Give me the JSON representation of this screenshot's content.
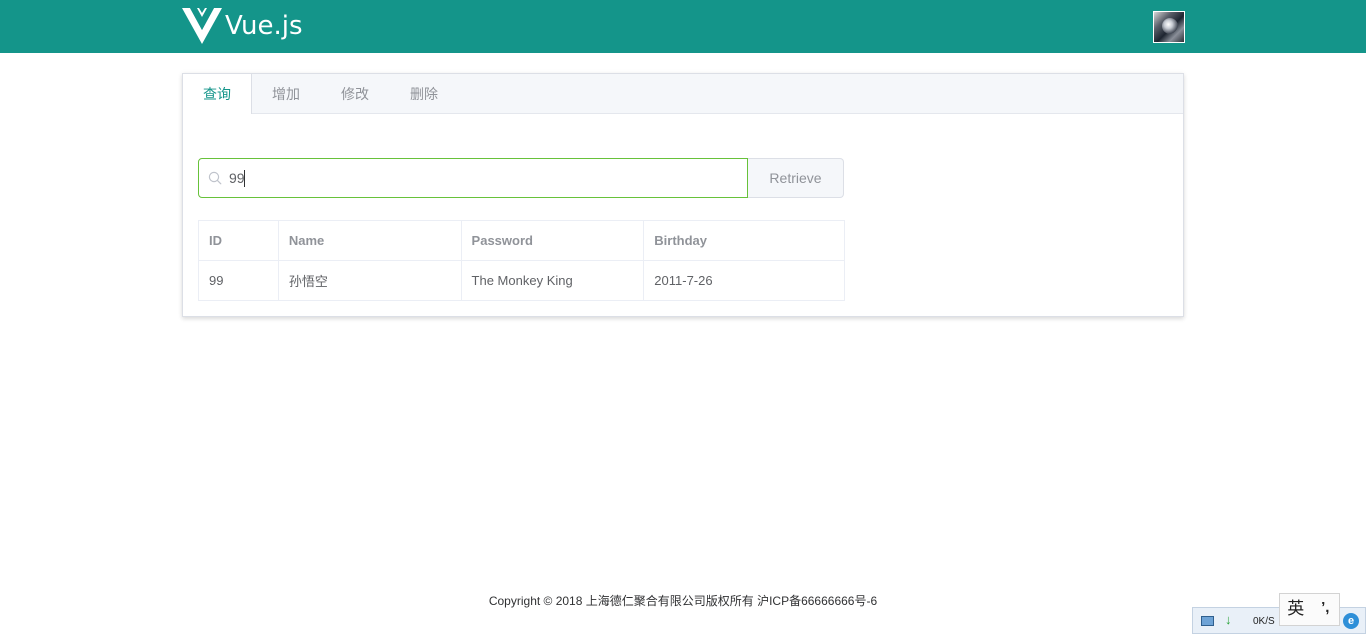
{
  "header": {
    "logo_text": "Vue.js",
    "accent_color": "#14958a",
    "avatar_icon": "user-avatar"
  },
  "tabs": [
    {
      "label": "查询",
      "active": true
    },
    {
      "label": "增加",
      "active": false
    },
    {
      "label": "修改",
      "active": false
    },
    {
      "label": "删除",
      "active": false
    }
  ],
  "search": {
    "value": "99",
    "placeholder": "",
    "button_label": "Retrieve"
  },
  "table": {
    "columns": [
      "ID",
      "Name",
      "Password",
      "Birthday"
    ],
    "rows": [
      [
        "99",
        "孙悟空",
        "The Monkey King",
        "2011-7-26"
      ]
    ]
  },
  "footer": {
    "copyright": "Copyright © 2018 上海德仁聚合有限公司版权所有 沪ICP备66666666号-6"
  },
  "tray": {
    "speed": "0K/S",
    "ime_language": "英",
    "ime_punctuation": "’,"
  }
}
